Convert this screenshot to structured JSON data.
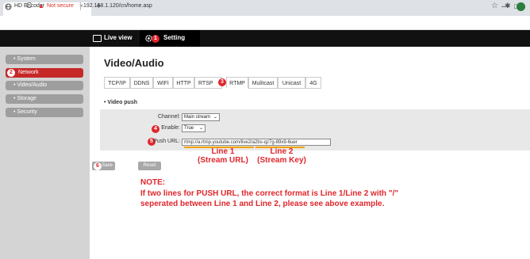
{
  "browser": {
    "tab_title": "HD Encoder",
    "tab_close": "×",
    "new_tab": "+",
    "not_secure": "Not secure",
    "url": "192.168.1.120/cn/home.asp",
    "back": "←",
    "forward": "→",
    "reload": "C",
    "warning": "▲",
    "star": "☆",
    "puzzle": "✱",
    "minimize": "—",
    "maximize": "□"
  },
  "header": {
    "live_view_label": "Live view",
    "setting_label": "Setting",
    "setting_badge": "1"
  },
  "sidebar": {
    "items": [
      {
        "label": "System",
        "active": false
      },
      {
        "label": "Network",
        "active": true,
        "badge": "2"
      },
      {
        "label": "Video/Audio",
        "active": false
      },
      {
        "label": "Storage",
        "active": false
      },
      {
        "label": "Security",
        "active": false
      }
    ],
    "bullet": "•"
  },
  "main": {
    "title": "Video/Audio",
    "tabs": [
      "TCP/IP",
      "DDNS",
      "WIFI",
      "HTTP",
      "RTSP",
      "RTMP",
      "Mulitcast",
      "Unicast",
      "4G"
    ],
    "active_tab": "RTMP",
    "rtmp_badge": "3",
    "section_title": "Video push",
    "section_bullet": "•",
    "form": {
      "channel_label": "Channel:",
      "channel_value": "Main stream",
      "enable_label": "Enable:",
      "enable_value": "True",
      "enable_badge": "4",
      "push_url_label": "Push URL:",
      "push_url_value": "rtmp://a.rtmp.youtube.com/live2/a2bs-qz7g-89x9-6uer",
      "push_url_badge": "5"
    },
    "annotations": {
      "line1_a": "Line 1",
      "line1_b": "(Stream URL)",
      "line2_a": "Line 2",
      "line2_b": "(Stream Key)"
    },
    "buttons": {
      "save": "Save",
      "save_badge": "6",
      "reset": "Reset"
    },
    "note": {
      "heading": "NOTE:",
      "line1": "If two lines for PUSH URL, the correct format is Line 1/Line 2 with \"/\"",
      "line2": "seperated between Line 1 and Line 2, please see above example."
    }
  },
  "colors": {
    "annotation_red": "#e0262c",
    "active_sidebar": "#c62828",
    "underline_orange": "#f0a000"
  }
}
